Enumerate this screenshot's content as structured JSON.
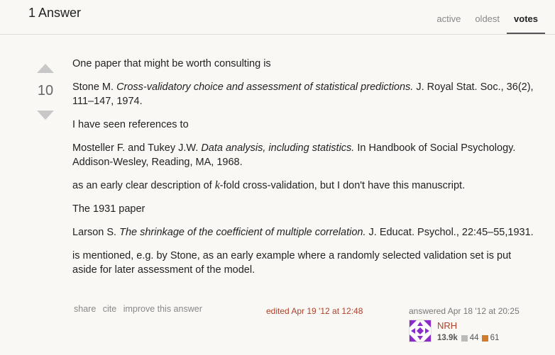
{
  "header": {
    "answers_count": "1 Answer",
    "tabs": [
      "active",
      "oldest",
      "votes"
    ],
    "active_tab": "votes"
  },
  "vote": {
    "score": "10"
  },
  "post": {
    "p1": "One paper that might be worth consulting is",
    "ref1_author": "Stone M. ",
    "ref1_title": "Cross-validatory choice and assessment of statistical predictions.",
    "ref1_rest": " J. Royal Stat. Soc., 36(2), 111–147, 1974.",
    "p2": "I have seen references to",
    "ref2_author": "Mosteller F. and Tukey J.W. ",
    "ref2_title": "Data analysis, including statistics.",
    "ref2_rest": " In Handbook of Social Psychology. Addison-Wesley, Reading, MA, 1968.",
    "p3_before": "as an early clear description of ",
    "p3_k": "k",
    "p3_after": "-fold cross-validation, but I don't have this manuscript.",
    "p4": "The 1931 paper",
    "ref3_author": "Larson S. ",
    "ref3_title": "The shrinkage of the coefficient of multiple correlation.",
    "ref3_rest": " J. Educat. Psychol., 22:45–55,1931.",
    "p5": "is mentioned, e.g. by Stone, as an early example where a randomly selected validation set is put aside for later assessment of the model."
  },
  "post_menu": {
    "share": "share",
    "cite": "cite",
    "improve": "improve this answer"
  },
  "edited": "edited Apr 19 '12 at 12:48",
  "answered": "answered Apr 18 '12 at 20:25",
  "user": {
    "name": "NRH",
    "reputation": "13.9k",
    "silver": "44",
    "bronze": "61",
    "avatar_color": "#8b2cc8"
  }
}
